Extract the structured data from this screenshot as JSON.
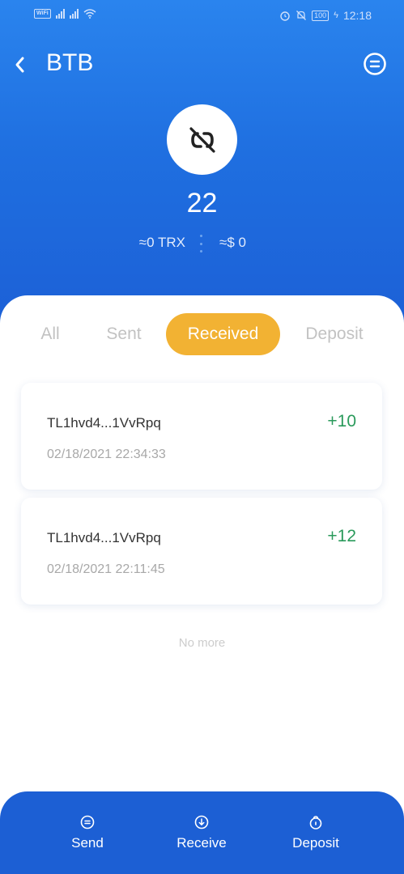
{
  "status_bar": {
    "wifi_label": "WiFi",
    "battery": "100",
    "time": "12:18"
  },
  "header": {
    "title": "BTB"
  },
  "token": {
    "balance": "22",
    "trx_value": "≈0 TRX",
    "usd_value": "≈$ 0",
    "logo_icon": "broken-link-icon"
  },
  "tabs": [
    {
      "label": "All",
      "active": false
    },
    {
      "label": "Sent",
      "active": false
    },
    {
      "label": "Received",
      "active": true
    },
    {
      "label": "Deposit",
      "active": false
    }
  ],
  "transactions": [
    {
      "address": "TL1hvd4...1VvRpq",
      "date": "02/18/2021 22:34:33",
      "amount": "+10"
    },
    {
      "address": "TL1hvd4...1VvRpq",
      "date": "02/18/2021 22:11:45",
      "amount": "+12"
    }
  ],
  "list_end_text": "No more",
  "bottom_bar": {
    "send_label": "Send",
    "receive_label": "Receive",
    "deposit_label": "Deposit"
  },
  "colors": {
    "primary_blue": "#1c5fd4",
    "active_tab": "#f2b233",
    "positive_amount": "#2a9a5b"
  }
}
